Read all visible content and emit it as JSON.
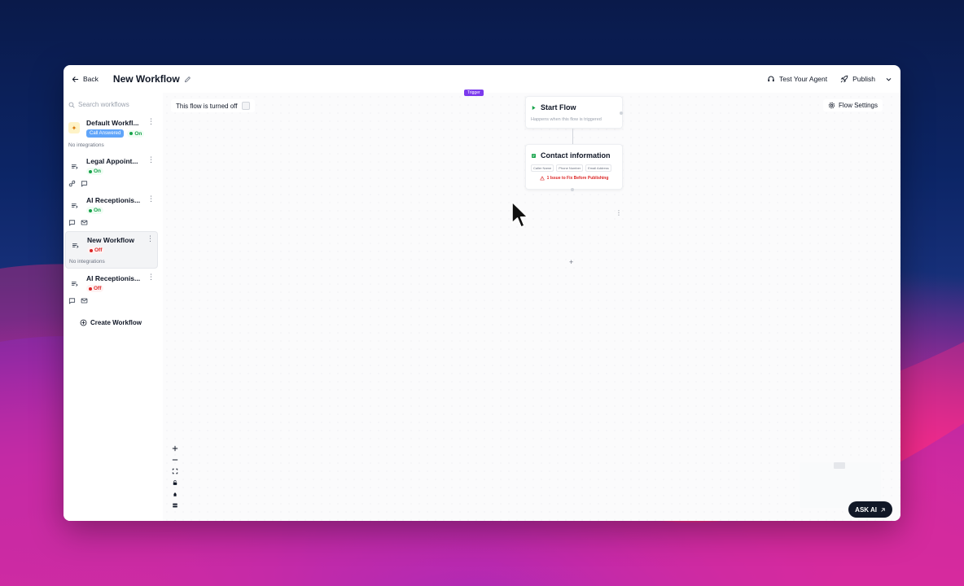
{
  "header": {
    "back_label": "Back",
    "workflow_title": "New Workflow",
    "test_agent_label": "Test Your Agent",
    "publish_label": "Publish"
  },
  "sidebar": {
    "search_placeholder": "Search workflows",
    "items": [
      {
        "name": "Default Workfl...",
        "badge": "Call Answered",
        "status": "On",
        "footer_text": "No integrations"
      },
      {
        "name": "Legal Appoint...",
        "status": "On"
      },
      {
        "name": "AI Receptionis...",
        "status": "On"
      },
      {
        "name": "New Workflow",
        "status": "Off",
        "footer_text": "No integrations"
      },
      {
        "name": "AI Receptionis...",
        "status": "Off"
      }
    ],
    "create_label": "Create Workflow"
  },
  "canvas": {
    "flow_status": "This flow is turned off",
    "flow_settings_label": "Flow Settings",
    "trigger_tag": "Trigger",
    "start_node": {
      "title": "Start Flow",
      "description": "Happens when this flow is triggered"
    },
    "contact_node": {
      "title": "Contact information",
      "chips": [
        "Caller Name",
        "Phone Number",
        "Email Address"
      ],
      "warning": "1 Issue to Fix Before Publishing"
    },
    "ask_ai_label": "ASK AI"
  },
  "colors": {
    "on": "#16a34a",
    "off": "#dc2626",
    "trigger": "#7c3aed",
    "badge": "#60a5fa"
  }
}
